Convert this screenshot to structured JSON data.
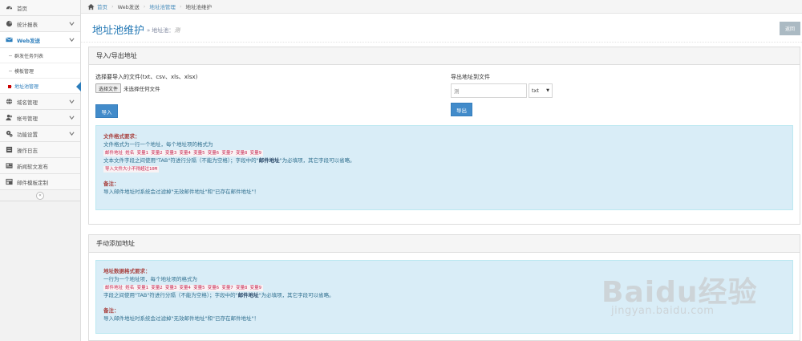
{
  "sidebar": {
    "items": [
      {
        "label": "首页",
        "icon": "tachometer-icon"
      },
      {
        "label": "统计报表",
        "icon": "pie-chart-icon"
      },
      {
        "label": "Web发送",
        "icon": "envelope-icon"
      },
      {
        "label": "域名管理",
        "icon": "globe-icon"
      },
      {
        "label": "帐号管理",
        "icon": "users-icon"
      },
      {
        "label": "功能设置",
        "icon": "cogs-icon"
      },
      {
        "label": "操作日志",
        "icon": "list-icon"
      },
      {
        "label": "新闻软文发布",
        "icon": "newspaper-icon"
      },
      {
        "label": "邮件模板定制",
        "icon": "template-icon"
      }
    ],
    "subitems": [
      {
        "label": "群发任务列表"
      },
      {
        "label": "模板管理"
      },
      {
        "label": "地址池管理"
      }
    ],
    "collapse_glyph": "«"
  },
  "breadcrumb": {
    "home": "首页",
    "level1": "Web发送",
    "level2": "地址池管理",
    "current": "地址池维护"
  },
  "header": {
    "title": "地址池维护",
    "subtitle_arrow": "»",
    "subtitle_prefix": "地址池：",
    "subtitle_value": "测",
    "return_label": "返回"
  },
  "import_panel": {
    "title": "导入/导出地址",
    "import_label": "选择要导入的文件(txt、csv、xls、xlsx)",
    "file_button": "选择文件",
    "file_status": "未选择任何文件",
    "import_button": "导入",
    "export_label": "导出地址到文件",
    "export_value": "测",
    "export_format": "txt",
    "export_button": "导出",
    "info": {
      "title": "文件格式要求：",
      "line1": "文件格式为一行一个地址，每个地址项的格式为",
      "code1": "邮件地址 姓名 变量1 变量2 变量3 变量4 变量5 变量6 变量7 变量8 变量9",
      "line2_a": "文本文件字段之间使用\"TAB\"符进行分隔（不能为空格）；字段中的\"",
      "line2_b": "邮件地址",
      "line2_c": "\"为必填项，其它字段可以省略。",
      "code2": "导入文件大小不得超过10M",
      "note_title": "备注：",
      "note_text": "导入邮件地址时系统会过滤掉\"无效邮件地址\"和\"已存在邮件地址\"！"
    }
  },
  "manual_panel": {
    "title": "手动添加地址",
    "info": {
      "title": "地址数据格式要求：",
      "line1": "一行为一个地址项，每个地址项的格式为",
      "code1": "邮件地址 姓名 变量1 变量2 变量3 变量4 变量5 变量6 变量7 变量8 变量9",
      "line2_a": "字段之间使用\"TAB\"符进行分隔（不能为空格）；字段中的\"",
      "line2_b": "邮件地址",
      "line2_c": "\"为必填项，其它字段可以省略。",
      "note_title": "备注：",
      "note_text": "导入邮件地址时系统会过滤掉\"无效邮件地址\"和\"已存在邮件地址\"！"
    }
  },
  "watermark": {
    "main": "Baidu经验",
    "sub": "jingyan.baidu.com"
  },
  "colors": {
    "accent": "#2679b5",
    "button": "#428bca",
    "info_bg": "#d9edf7",
    "info_title": "#a94442",
    "code_fg": "#c7254e"
  }
}
